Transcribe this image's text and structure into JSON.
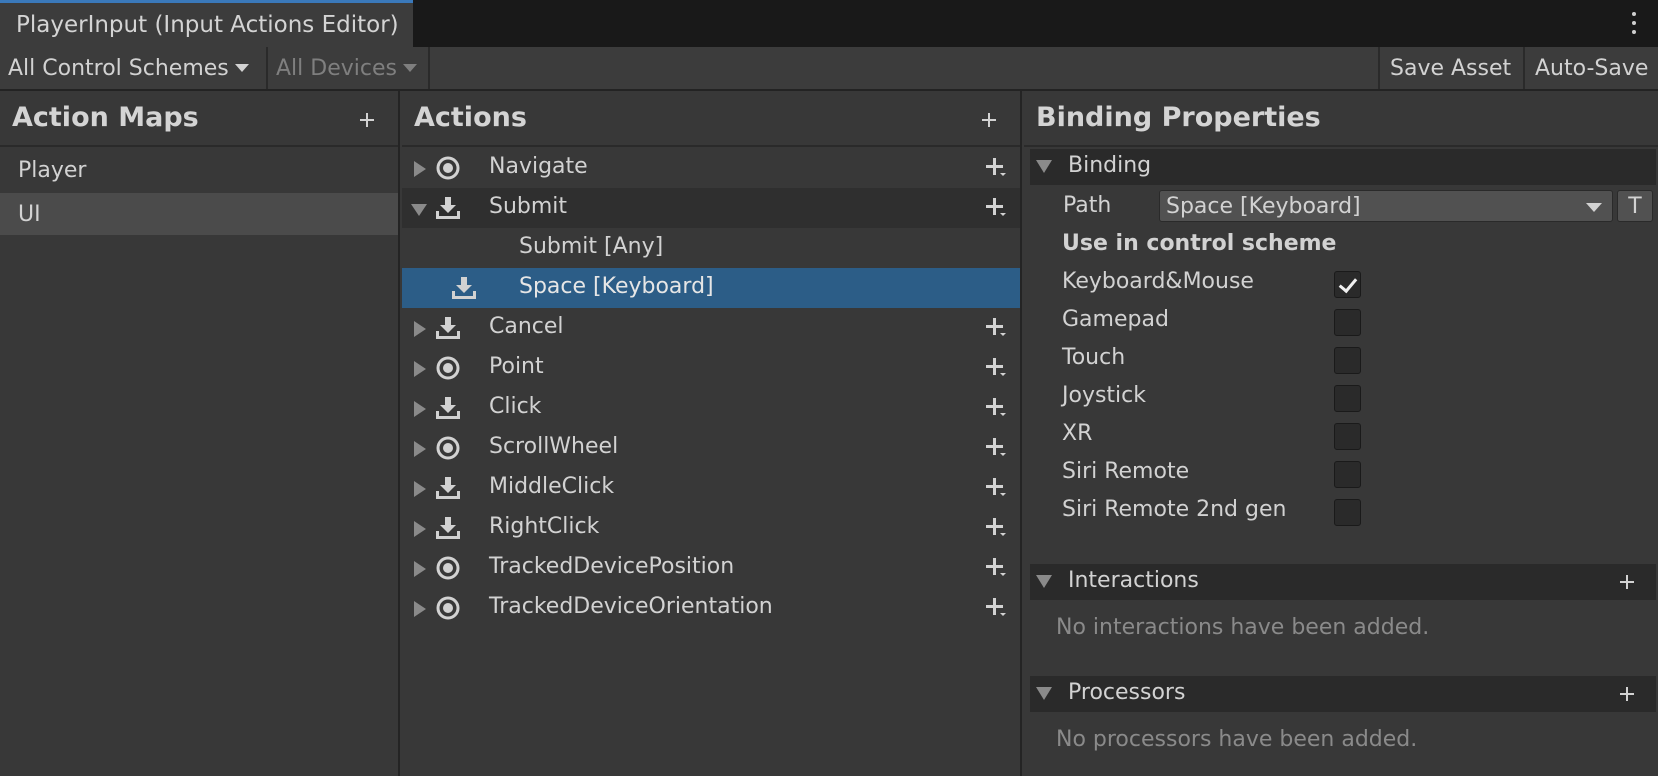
{
  "window": {
    "tab_title": "PlayerInput (Input Actions Editor)"
  },
  "toolbar": {
    "control_schemes": "All Control Schemes",
    "devices": "All Devices",
    "save_asset": "Save Asset",
    "auto_save": "Auto-Save"
  },
  "action_maps": {
    "header": "Action Maps",
    "items": [
      "Player",
      "UI"
    ],
    "selected": "UI"
  },
  "actions": {
    "header": "Actions",
    "rows": [
      {
        "label": "Navigate",
        "icon": "value-icon",
        "expanded": false
      },
      {
        "label": "Submit",
        "icon": "button-icon",
        "expanded": true
      },
      {
        "label": "Submit [Any]",
        "binding": true
      },
      {
        "label": "Space [Keyboard]",
        "binding": true,
        "icon": "button-icon",
        "selected": true
      },
      {
        "label": "Cancel",
        "icon": "button-icon",
        "expanded": false
      },
      {
        "label": "Point",
        "icon": "value-icon",
        "expanded": false
      },
      {
        "label": "Click",
        "icon": "button-icon",
        "expanded": false
      },
      {
        "label": "ScrollWheel",
        "icon": "value-icon",
        "expanded": false
      },
      {
        "label": "MiddleClick",
        "icon": "button-icon",
        "expanded": false
      },
      {
        "label": "RightClick",
        "icon": "button-icon",
        "expanded": false
      },
      {
        "label": "TrackedDevicePosition",
        "icon": "value-icon",
        "expanded": false
      },
      {
        "label": "TrackedDeviceOrientation",
        "icon": "value-icon",
        "expanded": false
      }
    ]
  },
  "binding_properties": {
    "header": "Binding Properties",
    "binding_section": "Binding",
    "path_label": "Path",
    "path_value": "Space [Keyboard]",
    "t_button": "T",
    "use_in_scheme_label": "Use in control scheme",
    "schemes": [
      {
        "name": "Keyboard&Mouse",
        "checked": true
      },
      {
        "name": "Gamepad",
        "checked": false
      },
      {
        "name": "Touch",
        "checked": false
      },
      {
        "name": "Joystick",
        "checked": false
      },
      {
        "name": "XR",
        "checked": false
      },
      {
        "name": "Siri Remote",
        "checked": false
      },
      {
        "name": "Siri Remote 2nd gen",
        "checked": false
      }
    ],
    "interactions_section": "Interactions",
    "interactions_empty": "No interactions have been added.",
    "processors_section": "Processors",
    "processors_empty": "No processors have been added."
  }
}
